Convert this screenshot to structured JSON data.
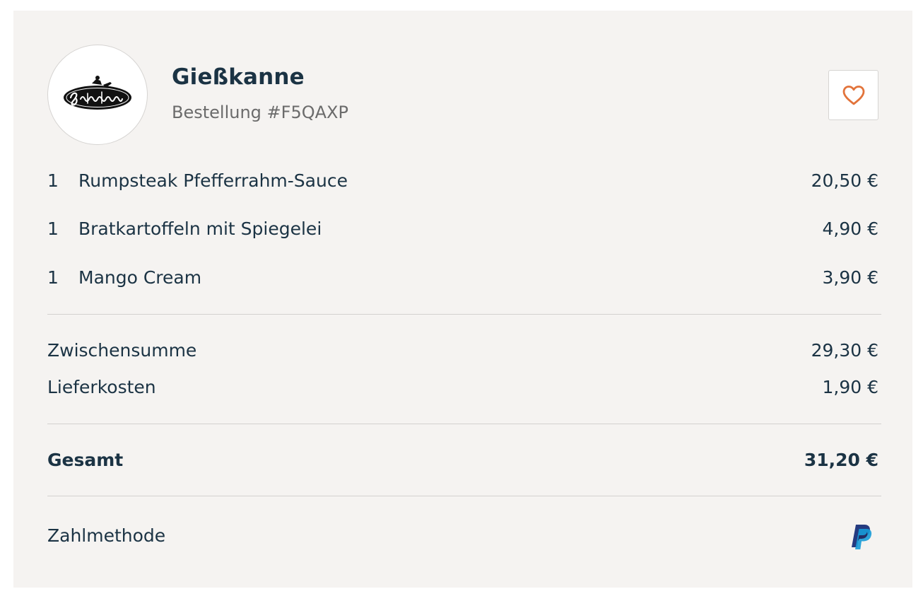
{
  "restaurant": {
    "name": "Gießkanne",
    "order_label": "Bestellung #F5QAXP",
    "logo_text": "Gießkanne"
  },
  "favorite": {
    "icon": "heart-icon",
    "color": "#e2733a"
  },
  "items": [
    {
      "qty": "1",
      "name": "Rumpsteak Pfefferrahm-Sauce",
      "price": "20,50 €"
    },
    {
      "qty": "1",
      "name": "Bratkartoffeln mit Spiegelei",
      "price": "4,90 €"
    },
    {
      "qty": "1",
      "name": "Mango Cream",
      "price": "3,90 €"
    }
  ],
  "summary": {
    "subtotal_label": "Zwischensumme",
    "subtotal_value": "29,30 €",
    "delivery_label": "Lieferkosten",
    "delivery_value": "1,90 €",
    "total_label": "Gesamt",
    "total_value": "31,20 €"
  },
  "payment": {
    "label": "Zahlmethode",
    "method_icon": "paypal-icon"
  },
  "colors": {
    "text_primary": "#1b3344",
    "text_secondary": "#6b6b6b",
    "card_background": "#f5f3f1",
    "accent": "#e2733a"
  }
}
